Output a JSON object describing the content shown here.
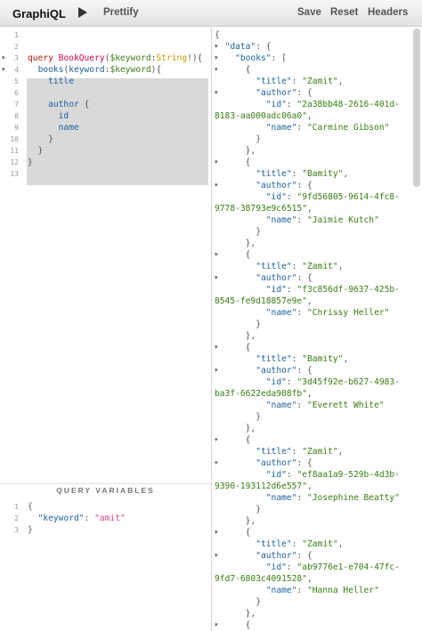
{
  "toolbar": {
    "app_title": "GraphiQL",
    "run_icon": "play-icon",
    "prettify_label": "Prettify",
    "save_label": "Save",
    "reset_label": "Reset",
    "headers_label": "Headers"
  },
  "query_editor": {
    "line_numbers": [
      "1",
      "2",
      "3",
      "4",
      "5",
      "6",
      "7",
      "8",
      "9",
      "10",
      "11",
      "12",
      "13"
    ],
    "lines": [
      {
        "parts": []
      },
      {
        "parts": []
      },
      {
        "parts": [
          {
            "c": "kw",
            "t": "query"
          },
          {
            "c": "pn",
            "t": " "
          },
          {
            "c": "def",
            "t": "BookQuery"
          },
          {
            "c": "pn",
            "t": "("
          },
          {
            "c": "var",
            "t": "$keyword"
          },
          {
            "c": "pn",
            "t": ":"
          },
          {
            "c": "typ",
            "t": "String"
          },
          {
            "c": "pn",
            "t": "!){"
          }
        ]
      },
      {
        "parts": [
          {
            "c": "pn",
            "t": "  "
          },
          {
            "c": "fld",
            "t": "books"
          },
          {
            "c": "pn",
            "t": "("
          },
          {
            "c": "fld",
            "t": "keyword"
          },
          {
            "c": "pn",
            "t": ":"
          },
          {
            "c": "var",
            "t": "$keyword"
          },
          {
            "c": "pn",
            "t": "){"
          }
        ]
      },
      {
        "parts": [
          {
            "c": "pn",
            "t": "    "
          },
          {
            "c": "fld",
            "t": "title"
          }
        ]
      },
      {
        "parts": []
      },
      {
        "parts": [
          {
            "c": "pn",
            "t": "    "
          },
          {
            "c": "fld",
            "t": "author"
          },
          {
            "c": "pn",
            "t": " {"
          }
        ]
      },
      {
        "parts": [
          {
            "c": "pn",
            "t": "      "
          },
          {
            "c": "fld",
            "t": "id"
          }
        ]
      },
      {
        "parts": [
          {
            "c": "pn",
            "t": "      "
          },
          {
            "c": "fld",
            "t": "name"
          }
        ]
      },
      {
        "parts": [
          {
            "c": "pn",
            "t": "    }"
          }
        ]
      },
      {
        "parts": [
          {
            "c": "pn",
            "t": "  }"
          }
        ]
      },
      {
        "parts": [
          {
            "c": "pn",
            "t": "}"
          }
        ]
      },
      {
        "parts": []
      }
    ]
  },
  "variables": {
    "title": "QUERY VARIABLES",
    "line_numbers": [
      "1",
      "2",
      "3"
    ],
    "lines": [
      {
        "parts": [
          {
            "c": "pn",
            "t": "{"
          }
        ]
      },
      {
        "parts": [
          {
            "c": "pn",
            "t": "  "
          },
          {
            "c": "prop",
            "t": "\"keyword\""
          },
          {
            "c": "pn",
            "t": ": "
          },
          {
            "c": "str",
            "t": "\"amit\""
          }
        ]
      },
      {
        "parts": [
          {
            "c": "pn",
            "t": "}"
          }
        ]
      }
    ]
  },
  "result": {
    "lines": [
      {
        "parts": [
          {
            "c": "pn",
            "t": "{"
          }
        ]
      },
      {
        "parts": [
          {
            "c": "pn",
            "t": "  "
          },
          {
            "c": "jkey",
            "t": "\"data\""
          },
          {
            "c": "pn",
            "t": ": {"
          }
        ],
        "fold": true
      },
      {
        "parts": [
          {
            "c": "pn",
            "t": "    "
          },
          {
            "c": "jkey",
            "t": "\"books\""
          },
          {
            "c": "pn",
            "t": ": ["
          }
        ],
        "fold": true
      },
      {
        "parts": [
          {
            "c": "pn",
            "t": "      {"
          }
        ],
        "fold": true
      },
      {
        "parts": [
          {
            "c": "pn",
            "t": "        "
          },
          {
            "c": "jkey",
            "t": "\"title\""
          },
          {
            "c": "pn",
            "t": ": "
          },
          {
            "c": "jstr",
            "t": "\"Zamit\""
          },
          {
            "c": "pn",
            "t": ","
          }
        ]
      },
      {
        "parts": [
          {
            "c": "pn",
            "t": "        "
          },
          {
            "c": "jkey",
            "t": "\"author\""
          },
          {
            "c": "pn",
            "t": ": {"
          }
        ],
        "fold": true
      },
      {
        "parts": [
          {
            "c": "pn",
            "t": "          "
          },
          {
            "c": "jkey",
            "t": "\"id\""
          },
          {
            "c": "pn",
            "t": ": "
          },
          {
            "c": "jstr",
            "t": "\"2a38bb48-2616-401d-"
          }
        ]
      },
      {
        "parts": [
          {
            "c": "jstr",
            "t": "8183-aa000adc06a0\""
          },
          {
            "c": "pn",
            "t": ","
          }
        ]
      },
      {
        "parts": [
          {
            "c": "pn",
            "t": "          "
          },
          {
            "c": "jkey",
            "t": "\"name\""
          },
          {
            "c": "pn",
            "t": ": "
          },
          {
            "c": "jstr",
            "t": "\"Carmine Gibson\""
          }
        ]
      },
      {
        "parts": [
          {
            "c": "pn",
            "t": "        }"
          }
        ]
      },
      {
        "parts": [
          {
            "c": "pn",
            "t": "      },"
          }
        ]
      },
      {
        "parts": [
          {
            "c": "pn",
            "t": "      {"
          }
        ],
        "fold": true
      },
      {
        "parts": [
          {
            "c": "pn",
            "t": "        "
          },
          {
            "c": "jkey",
            "t": "\"title\""
          },
          {
            "c": "pn",
            "t": ": "
          },
          {
            "c": "jstr",
            "t": "\"Bamity\""
          },
          {
            "c": "pn",
            "t": ","
          }
        ]
      },
      {
        "parts": [
          {
            "c": "pn",
            "t": "        "
          },
          {
            "c": "jkey",
            "t": "\"author\""
          },
          {
            "c": "pn",
            "t": ": {"
          }
        ],
        "fold": true
      },
      {
        "parts": [
          {
            "c": "pn",
            "t": "          "
          },
          {
            "c": "jkey",
            "t": "\"id\""
          },
          {
            "c": "pn",
            "t": ": "
          },
          {
            "c": "jstr",
            "t": "\"9fd56805-9614-4fc8-"
          }
        ]
      },
      {
        "parts": [
          {
            "c": "jstr",
            "t": "9778-38793e9c6515\""
          },
          {
            "c": "pn",
            "t": ","
          }
        ]
      },
      {
        "parts": [
          {
            "c": "pn",
            "t": "          "
          },
          {
            "c": "jkey",
            "t": "\"name\""
          },
          {
            "c": "pn",
            "t": ": "
          },
          {
            "c": "jstr",
            "t": "\"Jaimie Kutch\""
          }
        ]
      },
      {
        "parts": [
          {
            "c": "pn",
            "t": "        }"
          }
        ]
      },
      {
        "parts": [
          {
            "c": "pn",
            "t": "      },"
          }
        ]
      },
      {
        "parts": [
          {
            "c": "pn",
            "t": "      {"
          }
        ],
        "fold": true
      },
      {
        "parts": [
          {
            "c": "pn",
            "t": "        "
          },
          {
            "c": "jkey",
            "t": "\"title\""
          },
          {
            "c": "pn",
            "t": ": "
          },
          {
            "c": "jstr",
            "t": "\"Zamit\""
          },
          {
            "c": "pn",
            "t": ","
          }
        ]
      },
      {
        "parts": [
          {
            "c": "pn",
            "t": "        "
          },
          {
            "c": "jkey",
            "t": "\"author\""
          },
          {
            "c": "pn",
            "t": ": {"
          }
        ],
        "fold": true
      },
      {
        "parts": [
          {
            "c": "pn",
            "t": "          "
          },
          {
            "c": "jkey",
            "t": "\"id\""
          },
          {
            "c": "pn",
            "t": ": "
          },
          {
            "c": "jstr",
            "t": "\"f3c856df-9637-425b-"
          }
        ]
      },
      {
        "parts": [
          {
            "c": "jstr",
            "t": "8545-fe9d18857e9e\""
          },
          {
            "c": "pn",
            "t": ","
          }
        ]
      },
      {
        "parts": [
          {
            "c": "pn",
            "t": "          "
          },
          {
            "c": "jkey",
            "t": "\"name\""
          },
          {
            "c": "pn",
            "t": ": "
          },
          {
            "c": "jstr",
            "t": "\"Chrissy Heller\""
          }
        ]
      },
      {
        "parts": [
          {
            "c": "pn",
            "t": "        }"
          }
        ]
      },
      {
        "parts": [
          {
            "c": "pn",
            "t": "      },"
          }
        ]
      },
      {
        "parts": [
          {
            "c": "pn",
            "t": "      {"
          }
        ],
        "fold": true
      },
      {
        "parts": [
          {
            "c": "pn",
            "t": "        "
          },
          {
            "c": "jkey",
            "t": "\"title\""
          },
          {
            "c": "pn",
            "t": ": "
          },
          {
            "c": "jstr",
            "t": "\"Bamity\""
          },
          {
            "c": "pn",
            "t": ","
          }
        ]
      },
      {
        "parts": [
          {
            "c": "pn",
            "t": "        "
          },
          {
            "c": "jkey",
            "t": "\"author\""
          },
          {
            "c": "pn",
            "t": ": {"
          }
        ],
        "fold": true
      },
      {
        "parts": [
          {
            "c": "pn",
            "t": "          "
          },
          {
            "c": "jkey",
            "t": "\"id\""
          },
          {
            "c": "pn",
            "t": ": "
          },
          {
            "c": "jstr",
            "t": "\"3d45f92e-b627-4983-"
          }
        ]
      },
      {
        "parts": [
          {
            "c": "jstr",
            "t": "ba3f-6622eda908fb\""
          },
          {
            "c": "pn",
            "t": ","
          }
        ]
      },
      {
        "parts": [
          {
            "c": "pn",
            "t": "          "
          },
          {
            "c": "jkey",
            "t": "\"name\""
          },
          {
            "c": "pn",
            "t": ": "
          },
          {
            "c": "jstr",
            "t": "\"Everett White\""
          }
        ]
      },
      {
        "parts": [
          {
            "c": "pn",
            "t": "        }"
          }
        ]
      },
      {
        "parts": [
          {
            "c": "pn",
            "t": "      },"
          }
        ]
      },
      {
        "parts": [
          {
            "c": "pn",
            "t": "      {"
          }
        ],
        "fold": true
      },
      {
        "parts": [
          {
            "c": "pn",
            "t": "        "
          },
          {
            "c": "jkey",
            "t": "\"title\""
          },
          {
            "c": "pn",
            "t": ": "
          },
          {
            "c": "jstr",
            "t": "\"Zamit\""
          },
          {
            "c": "pn",
            "t": ","
          }
        ]
      },
      {
        "parts": [
          {
            "c": "pn",
            "t": "        "
          },
          {
            "c": "jkey",
            "t": "\"author\""
          },
          {
            "c": "pn",
            "t": ": {"
          }
        ],
        "fold": true
      },
      {
        "parts": [
          {
            "c": "pn",
            "t": "          "
          },
          {
            "c": "jkey",
            "t": "\"id\""
          },
          {
            "c": "pn",
            "t": ": "
          },
          {
            "c": "jstr",
            "t": "\"ef8aa1a9-529b-4d3b-"
          }
        ]
      },
      {
        "parts": [
          {
            "c": "jstr",
            "t": "9390-193112d6e557\""
          },
          {
            "c": "pn",
            "t": ","
          }
        ]
      },
      {
        "parts": [
          {
            "c": "pn",
            "t": "          "
          },
          {
            "c": "jkey",
            "t": "\"name\""
          },
          {
            "c": "pn",
            "t": ": "
          },
          {
            "c": "jstr",
            "t": "\"Josephine Beatty\""
          }
        ]
      },
      {
        "parts": [
          {
            "c": "pn",
            "t": "        }"
          }
        ]
      },
      {
        "parts": [
          {
            "c": "pn",
            "t": "      },"
          }
        ]
      },
      {
        "parts": [
          {
            "c": "pn",
            "t": "      {"
          }
        ],
        "fold": true
      },
      {
        "parts": [
          {
            "c": "pn",
            "t": "        "
          },
          {
            "c": "jkey",
            "t": "\"title\""
          },
          {
            "c": "pn",
            "t": ": "
          },
          {
            "c": "jstr",
            "t": "\"Zamit\""
          },
          {
            "c": "pn",
            "t": ","
          }
        ]
      },
      {
        "parts": [
          {
            "c": "pn",
            "t": "        "
          },
          {
            "c": "jkey",
            "t": "\"author\""
          },
          {
            "c": "pn",
            "t": ": {"
          }
        ],
        "fold": true
      },
      {
        "parts": [
          {
            "c": "pn",
            "t": "          "
          },
          {
            "c": "jkey",
            "t": "\"id\""
          },
          {
            "c": "pn",
            "t": ": "
          },
          {
            "c": "jstr",
            "t": "\"ab9776e1-e704-47fc-"
          }
        ]
      },
      {
        "parts": [
          {
            "c": "jstr",
            "t": "9fd7-6803c4091528\""
          },
          {
            "c": "pn",
            "t": ","
          }
        ]
      },
      {
        "parts": [
          {
            "c": "pn",
            "t": "          "
          },
          {
            "c": "jkey",
            "t": "\"name\""
          },
          {
            "c": "pn",
            "t": ": "
          },
          {
            "c": "jstr",
            "t": "\"Hanna Heller\""
          }
        ]
      },
      {
        "parts": [
          {
            "c": "pn",
            "t": "        }"
          }
        ]
      },
      {
        "parts": [
          {
            "c": "pn",
            "t": "      },"
          }
        ]
      },
      {
        "parts": [
          {
            "c": "pn",
            "t": "      {"
          }
        ],
        "fold": true
      }
    ]
  }
}
